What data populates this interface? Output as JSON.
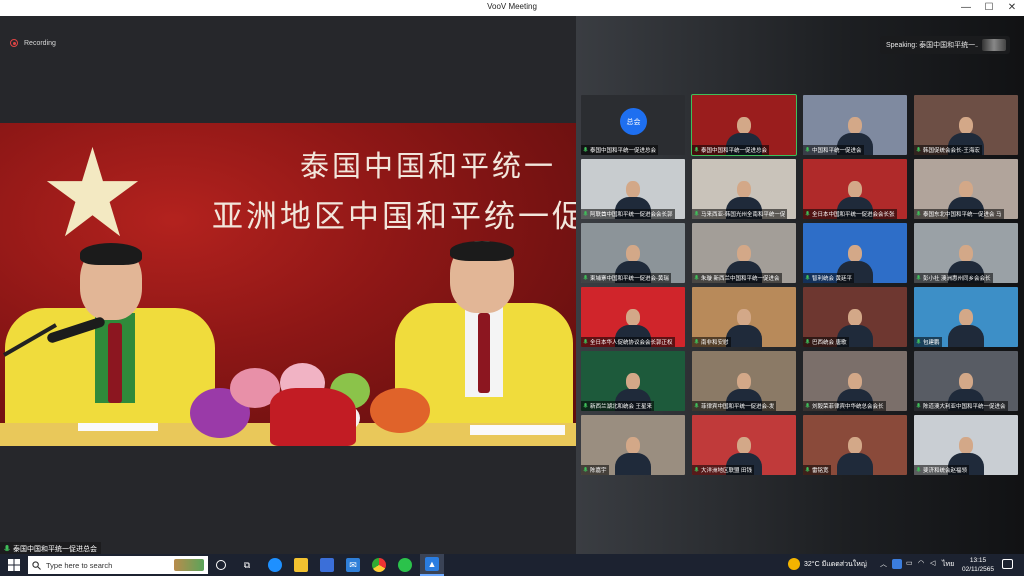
{
  "window": {
    "title": "VooV Meeting",
    "minimize": "—",
    "maximize": "☐",
    "close": "✕"
  },
  "recording": {
    "label": "Recording",
    "color": "#e04545"
  },
  "main_video": {
    "banner_line1": "泰国中国和平统一",
    "banner_line2": "亚洲地区中国和平统一促",
    "speaker_name": "泰国中国和平统一促进总会"
  },
  "speaking": {
    "label": "Speaking: 泰国中国和平统一..."
  },
  "participants": [
    {
      "name": "泰国中国和平统一促进总会",
      "avatar": "总会",
      "bg": "#2b2d31"
    },
    {
      "name": "泰国中国和平统一促进总会",
      "bg": "#9a1d1d",
      "active": true
    },
    {
      "name": "中国和平统一促进会",
      "bg": "#7f8aa0"
    },
    {
      "name": "韩国促统会会长-王海宏",
      "bg": "#6d4f45"
    },
    {
      "name": "阿联酋中国和平统一促进会会长郭",
      "bg": "#c8cccf"
    },
    {
      "name": "马来西亚-韩国光州全南和平统一促",
      "bg": "#c9c3ba"
    },
    {
      "name": "全日本中国和平统一促进会会长张",
      "bg": "#b02a2a"
    },
    {
      "name": "泰国东北中国和平统一促进会 马",
      "bg": "#b1a49b"
    },
    {
      "name": "柬埔寨中国和平统一促进会-黄瑞",
      "bg": "#8c9499"
    },
    {
      "name": "朱璇 新西兰中国和平统一促进会",
      "bg": "#a39e98"
    },
    {
      "name": "智利统会 黄廷平",
      "bg": "#2e6ec8"
    },
    {
      "name": "彭小社 澳洲惠州同乡会会长",
      "bg": "#9aa1a6"
    },
    {
      "name": "全日本华人促统协议会会长郭正权",
      "bg": "#d0252b"
    },
    {
      "name": "南非和安慰",
      "bg": "#b88a5a"
    },
    {
      "name": "巴西统会 唐歌",
      "bg": "#6e3730"
    },
    {
      "name": "包建鹏",
      "bg": "#3d8fc7"
    },
    {
      "name": "新西兰湖北和统会 王星来",
      "bg": "#1d5a3b"
    },
    {
      "name": "菲律宾中国和平统一促进会-发",
      "bg": "#8b7a66"
    },
    {
      "name": "刘毅荣菲律宾中华统总会会长",
      "bg": "#7b6f6a"
    },
    {
      "name": "陈道澳大利亚中国和平统一促进会",
      "bg": "#585c64"
    },
    {
      "name": "陈嘉宇",
      "bg": "#9a8e80"
    },
    {
      "name": "大洋洲地区联盟 田钱",
      "bg": "#c03a3a"
    },
    {
      "name": "雷铭宽",
      "bg": "#8a4a3a"
    },
    {
      "name": "斐济和统会赵福领",
      "bg": "#c9ced3"
    }
  ],
  "taskbar": {
    "search_placeholder": "Type here to search",
    "weather": "32°C  มีแดดส่วนใหญ่",
    "language": "ไทย",
    "time": "13:15",
    "date": "02/11/2565"
  }
}
